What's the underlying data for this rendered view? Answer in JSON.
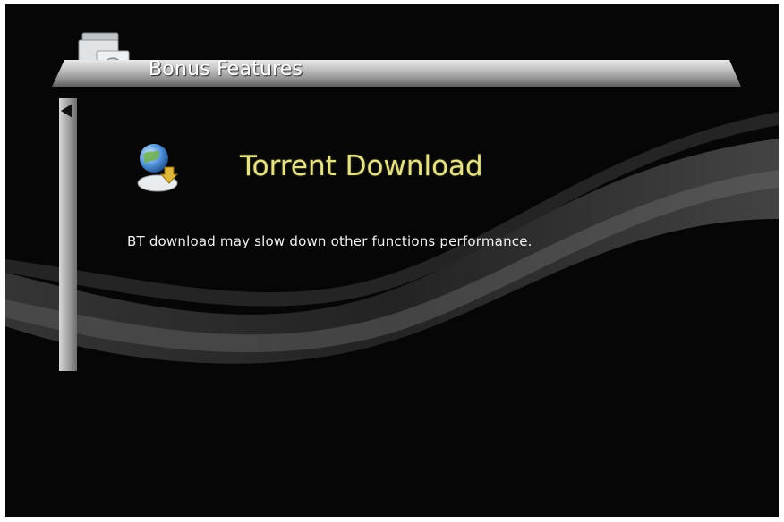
{
  "header": {
    "title": "Bonus Features",
    "icon": "bonus-features-folder-icon"
  },
  "feature": {
    "title": "Torrent Download",
    "icon": "torrent-globe-icon",
    "title_color": "#e5e08a"
  },
  "message": "BT download may slow down other functions performance.",
  "colors": {
    "background": "#060606",
    "header_bar": "#b8b8b8",
    "text": "#f2f2f2"
  }
}
